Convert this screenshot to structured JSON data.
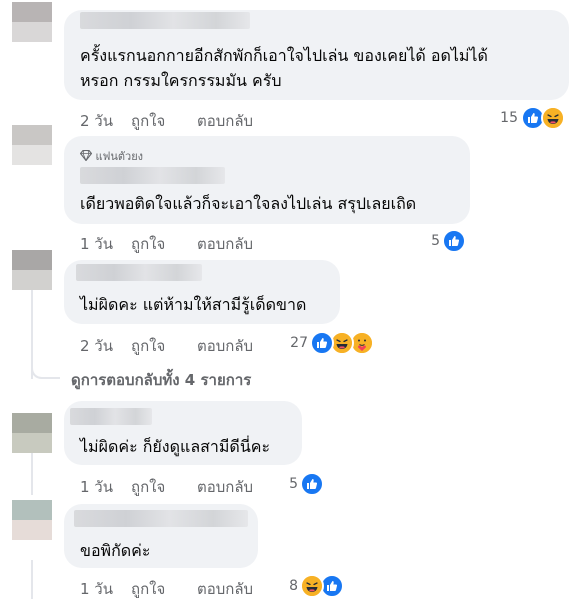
{
  "comments": [
    {
      "text_lines": [
        "ครั้งแรกนอกกายอีกสักพักก็เอาใจไปเล่น ของเคยได้ อดไม่ได้",
        "หรอก กรรมใครกรรมมัน ครับ"
      ],
      "time": "2 วัน",
      "like_label": "ถูกใจ",
      "reply_label": "ตอบกลับ",
      "reaction_count": "15",
      "reactions": [
        "like-icon",
        "haha-icon"
      ]
    },
    {
      "badge": "แฟนตัวยง",
      "text_lines": [
        "เดียวพอติดใจแล้วก็จะเอาใจลงไปเล่น สรุปเลยเถิด"
      ],
      "time": "1 วัน",
      "like_label": "ถูกใจ",
      "reply_label": "ตอบกลับ",
      "reaction_count": "5",
      "reactions": [
        "like-icon"
      ]
    },
    {
      "text_lines": [
        "ไม่ผิดคะ แต่ห้ามให้สามีรู้เด็ดขาด"
      ],
      "time": "2 วัน",
      "like_label": "ถูกใจ",
      "reply_label": "ตอบกลับ",
      "reaction_count": "27",
      "reactions": [
        "like-icon",
        "haha-icon",
        "love-icon"
      ],
      "view_replies": "ดูการตอบกลับทั้ง 4 รายการ"
    },
    {
      "text_lines": [
        "ไม่ผิดค่ะ ก็ยังดูแลสามีดีนี่คะ"
      ],
      "time": "1 วัน",
      "like_label": "ถูกใจ",
      "reply_label": "ตอบกลับ",
      "reaction_count": "5",
      "reactions": [
        "like-icon"
      ]
    },
    {
      "text_lines": [
        "ขอพิกัดค่ะ"
      ],
      "time": "1 วัน",
      "like_label": "ถูกใจ",
      "reply_label": "ตอบกลับ",
      "reaction_count": "8",
      "reactions": [
        "haha-icon",
        "like-icon"
      ]
    }
  ],
  "colors": {
    "like": "#1877f2",
    "haha": "#f7b125",
    "bubble": "#f0f2f5",
    "meta": "#65676b"
  }
}
